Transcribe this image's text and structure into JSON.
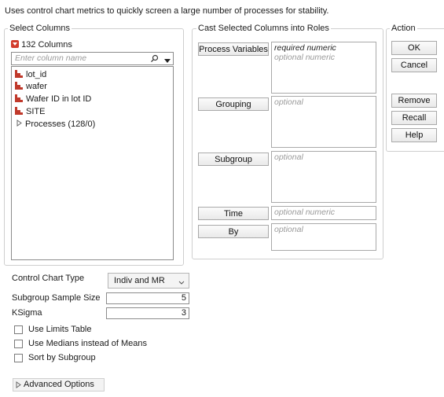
{
  "header_text": "Uses control chart metrics to quickly screen a large number of processes for stability.",
  "select_columns": {
    "title": "Select Columns",
    "count_label": "132 Columns",
    "search_placeholder": "Enter column name",
    "items": [
      {
        "label": "lot_id",
        "icon": "nominal-bar-icon"
      },
      {
        "label": "wafer",
        "icon": "nominal-bar-icon"
      },
      {
        "label": "Wafer ID in lot ID",
        "icon": "nominal-bar-icon"
      },
      {
        "label": "SITE",
        "icon": "nominal-bar-icon"
      }
    ],
    "group_item": "Processes (128/0)"
  },
  "cast": {
    "title": "Cast Selected Columns into Roles",
    "roles": [
      {
        "label": "Process Variables",
        "lines": [
          "required numeric",
          "optional numeric"
        ]
      },
      {
        "label": "Grouping",
        "lines": [
          "optional"
        ]
      },
      {
        "label": "Subgroup",
        "lines": [
          "optional"
        ]
      },
      {
        "label": "Time",
        "lines": [
          "optional numeric"
        ]
      },
      {
        "label": "By",
        "lines": [
          "optional"
        ]
      }
    ]
  },
  "action": {
    "title": "Action",
    "ok": "OK",
    "cancel": "Cancel",
    "remove": "Remove",
    "recall": "Recall",
    "help": "Help"
  },
  "options": {
    "control_chart_type_label": "Control Chart Type",
    "control_chart_type_value": "Indiv and MR",
    "subgroup_size_label": "Subgroup Sample Size",
    "subgroup_size_value": "5",
    "ksigma_label": "KSigma",
    "ksigma_value": "3",
    "checkboxes": [
      "Use Limits Table",
      "Use Medians instead of Means",
      "Sort by Subgroup"
    ],
    "advanced": "Advanced Options"
  },
  "colors": {
    "accent_red": "#c0392b"
  }
}
